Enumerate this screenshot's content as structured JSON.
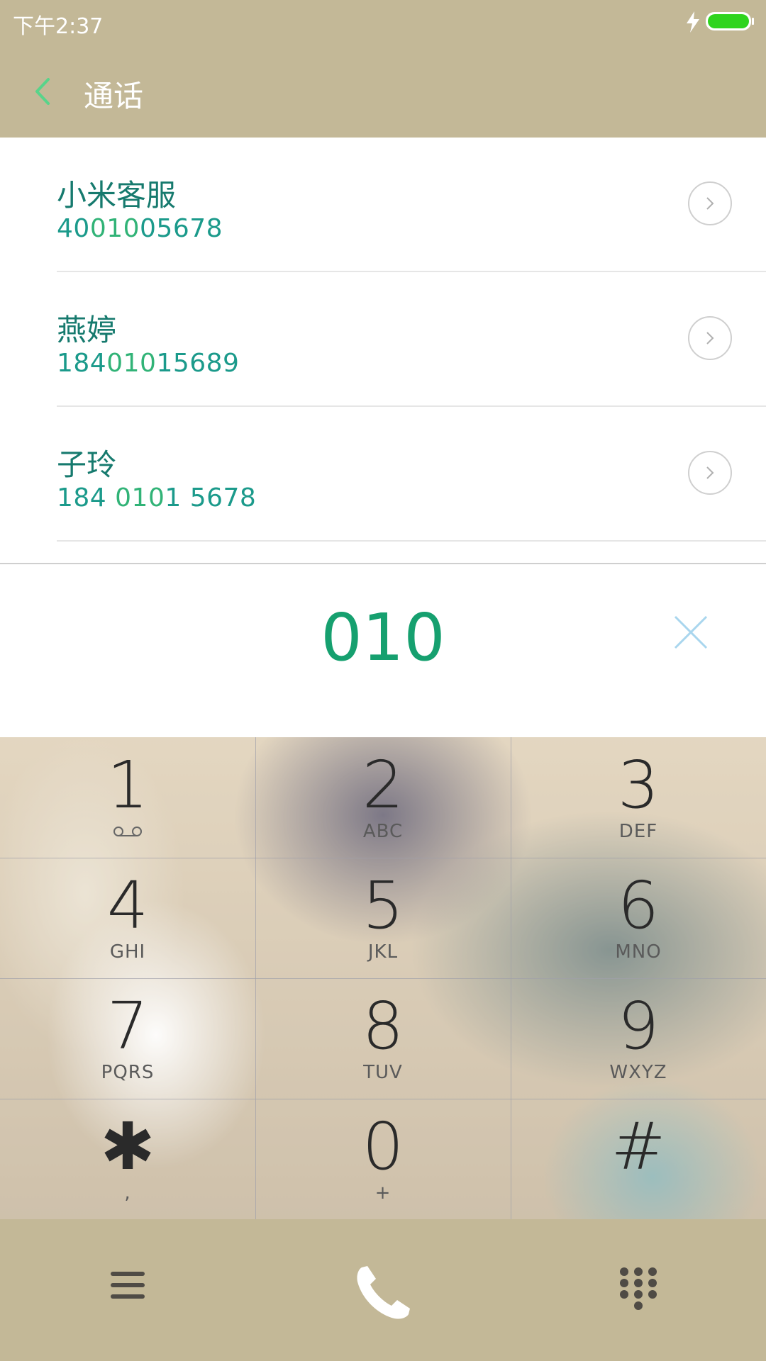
{
  "status": {
    "time": "下午2:37",
    "battery_color": "#2fd41e"
  },
  "title": "通话",
  "contacts": [
    {
      "name": "小米客服",
      "number_pre": "40",
      "number_match": "010",
      "number_post": "05678"
    },
    {
      "name": "燕婷",
      "number_pre": "184",
      "number_match": "010",
      "number_post": "15689"
    },
    {
      "name": "子玲",
      "number_pre": "184 ",
      "number_match": "010",
      "number_post": "1 5678"
    }
  ],
  "dialed": "010",
  "keys": [
    {
      "digit": "1",
      "letters": ""
    },
    {
      "digit": "2",
      "letters": "ABC"
    },
    {
      "digit": "3",
      "letters": "DEF"
    },
    {
      "digit": "4",
      "letters": "GHI"
    },
    {
      "digit": "5",
      "letters": "JKL"
    },
    {
      "digit": "6",
      "letters": "MNO"
    },
    {
      "digit": "7",
      "letters": "PQRS"
    },
    {
      "digit": "8",
      "letters": "TUV"
    },
    {
      "digit": "9",
      "letters": "WXYZ"
    },
    {
      "digit": "✱",
      "letters": ","
    },
    {
      "digit": "0",
      "letters": "+"
    },
    {
      "digit": "#",
      "letters": ""
    }
  ],
  "icons": {
    "back": "chevron-left-icon",
    "detail": "chevron-right-circle-icon",
    "clear": "close-icon",
    "voicemail": "voicemail-icon",
    "menu": "menu-icon",
    "call": "phone-icon",
    "keypad": "dialpad-icon"
  },
  "colors": {
    "accent_green": "#16a06f",
    "bar_background": "#c3b897",
    "name_color": "#167a6e"
  }
}
